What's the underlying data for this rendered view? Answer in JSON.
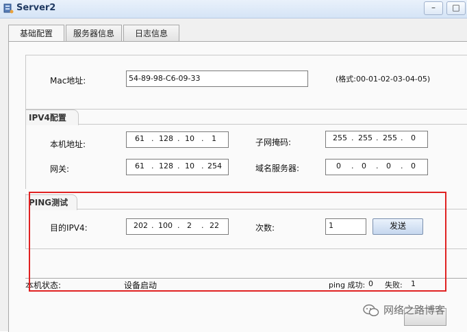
{
  "window": {
    "title": "Server2"
  },
  "tabs": [
    {
      "label": "基础配置"
    },
    {
      "label": "服务器信息"
    },
    {
      "label": "日志信息"
    }
  ],
  "mac": {
    "label": "Mac地址:",
    "value": "54-89-98-C6-09-33",
    "format_hint": "(格式:00-01-02-03-04-05)"
  },
  "ipv4": {
    "section_title": "IPV4配置",
    "ip_label": "本机地址:",
    "ip": [
      "61",
      "128",
      "10",
      "1"
    ],
    "mask_label": "子网掩码:",
    "mask": [
      "255",
      "255",
      "255",
      "0"
    ],
    "gateway_label": "网关:",
    "gateway": [
      "61",
      "128",
      "10",
      "254"
    ],
    "dns_label": "域名服务器:",
    "dns": [
      "0",
      "0",
      "0",
      "0"
    ]
  },
  "ping": {
    "section_title": "PING测试",
    "target_label": "目的IPV4:",
    "target": [
      "202",
      "100",
      "2",
      "22"
    ],
    "count_label": "次数:",
    "count": "1",
    "send_label": "发送"
  },
  "status": {
    "label": "本机状态:",
    "value": "设备启动",
    "ping_success_label": "ping 成功:",
    "ping_success": "0",
    "fail_label": "失败:",
    "fail": "1"
  },
  "watermark": {
    "text": "网络之路博客"
  },
  "colors": {
    "highlight_box": "#e02020",
    "title_text": "#203a62"
  }
}
